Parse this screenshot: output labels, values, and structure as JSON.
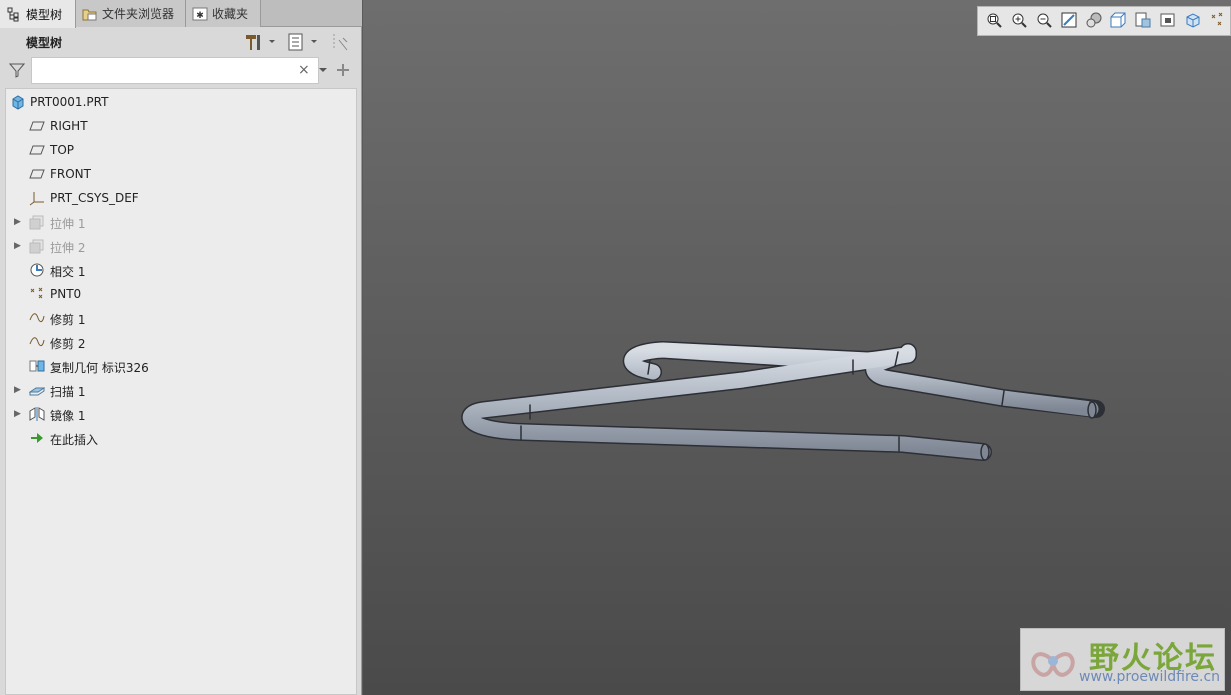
{
  "tabs": [
    {
      "label": "模型树",
      "icon": "model-tree-icon",
      "active": true
    },
    {
      "label": "文件夹浏览器",
      "icon": "folder-browser-icon",
      "active": false
    },
    {
      "label": "收藏夹",
      "icon": "favorites-icon",
      "active": false
    }
  ],
  "panel": {
    "title": "模型树"
  },
  "search": {
    "value": "",
    "clear_glyph": "×"
  },
  "tree": [
    {
      "label": "PRT0001.PRT",
      "icon": "part-icon",
      "level": 0,
      "expandable": false,
      "dim": false
    },
    {
      "label": "RIGHT",
      "icon": "datum-plane-icon",
      "level": 1,
      "expandable": false,
      "dim": false
    },
    {
      "label": "TOP",
      "icon": "datum-plane-icon",
      "level": 1,
      "expandable": false,
      "dim": false
    },
    {
      "label": "FRONT",
      "icon": "datum-plane-icon",
      "level": 1,
      "expandable": false,
      "dim": false
    },
    {
      "label": "PRT_CSYS_DEF",
      "icon": "coordinate-system-icon",
      "level": 1,
      "expandable": false,
      "dim": false
    },
    {
      "label": "拉伸 1",
      "icon": "extrude-icon",
      "level": 1,
      "expandable": true,
      "dim": true
    },
    {
      "label": "拉伸 2",
      "icon": "extrude-icon",
      "level": 1,
      "expandable": true,
      "dim": true
    },
    {
      "label": "相交 1",
      "icon": "intersect-icon",
      "level": 1,
      "expandable": false,
      "dim": false
    },
    {
      "label": "PNT0",
      "icon": "datum-point-icon",
      "level": 1,
      "expandable": false,
      "dim": false
    },
    {
      "label": "修剪 1",
      "icon": "curve-icon",
      "level": 1,
      "expandable": false,
      "dim": false
    },
    {
      "label": "修剪 2",
      "icon": "curve-icon",
      "level": 1,
      "expandable": false,
      "dim": false
    },
    {
      "label": "复制几何 标识326",
      "icon": "copy-geometry-icon",
      "level": 1,
      "expandable": false,
      "dim": false
    },
    {
      "label": "扫描 1",
      "icon": "sweep-icon",
      "level": 1,
      "expandable": true,
      "dim": false
    },
    {
      "label": "镜像 1",
      "icon": "mirror-icon",
      "level": 1,
      "expandable": true,
      "dim": false
    },
    {
      "label": "在此插入",
      "icon": "insert-here-icon",
      "level": 1,
      "expandable": false,
      "dim": false
    }
  ],
  "view_toolbar": [
    "refit-icon",
    "zoom-in-icon",
    "zoom-out-icon",
    "repaint-icon",
    "display-style-icon",
    "saved-orientations-icon",
    "view-manager-icon",
    "perspective-icon",
    "section-icon",
    "datum-display-icon"
  ],
  "watermark": {
    "title": "野火论坛",
    "url": "www.proewildfire.cn"
  },
  "colors": {
    "viewport_top": "#6e6e6e",
    "viewport_bottom": "#4a4a4a",
    "tube": "#aeb6c2",
    "panel": "#ececec"
  }
}
